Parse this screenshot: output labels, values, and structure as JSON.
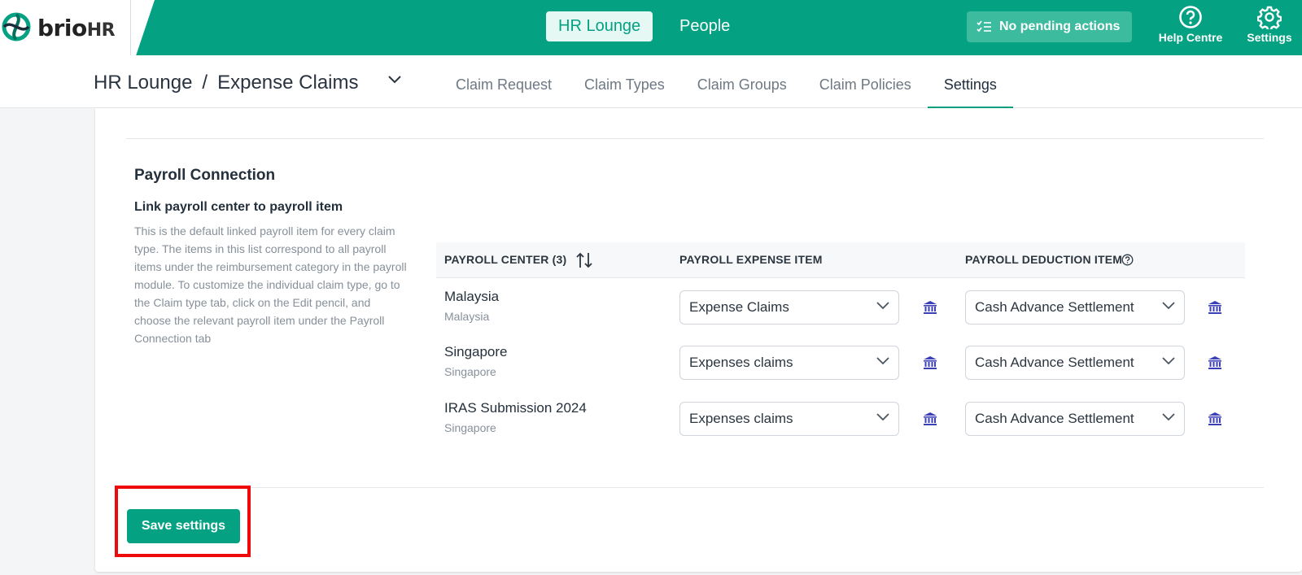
{
  "brand": {
    "name": "brio",
    "suffix": "HR",
    "colors": {
      "primary": "#05a183",
      "highlight": "#ee0a0a",
      "bank_icon": "#3b3fb8"
    }
  },
  "topnav": {
    "items": [
      {
        "label": "HR Lounge",
        "active": true
      },
      {
        "label": "People",
        "active": false
      }
    ],
    "pending_label": "No pending actions",
    "help_label": "Help Centre",
    "settings_label": "Settings"
  },
  "breadcrumb": {
    "root": "HR Lounge",
    "separator": "/",
    "current": "Expense Claims"
  },
  "tabs": [
    {
      "label": "Claim Request",
      "active": false
    },
    {
      "label": "Claim Types",
      "active": false
    },
    {
      "label": "Claim Groups",
      "active": false
    },
    {
      "label": "Claim Policies",
      "active": false
    },
    {
      "label": "Settings",
      "active": true
    }
  ],
  "section": {
    "title": "Payroll Connection",
    "subtitle": "Link payroll center to payroll item",
    "description": "This is the default linked payroll item for every claim type. The items in this list correspond to all payroll items under the reimbursement category in the payroll module. To customize the individual claim type, go to the Claim type tab, click on the Edit pencil, and choose the relevant payroll item under the Payroll Connection tab"
  },
  "table": {
    "headers": {
      "center": "PAYROLL CENTER (3)",
      "expense": "PAYROLL EXPENSE ITEM",
      "deduction": "PAYROLL DEDUCTION ITEM"
    },
    "rows": [
      {
        "name": "Malaysia",
        "country": "Malaysia",
        "expense": "Expense Claims",
        "deduction": "Cash Advance Settlement"
      },
      {
        "name": "Singapore",
        "country": "Singapore",
        "expense": "Expenses claims",
        "deduction": "Cash Advance Settlement"
      },
      {
        "name": "IRAS Submission 2024",
        "country": "Singapore",
        "expense": "Expenses claims",
        "deduction": "Cash Advance Settlement"
      }
    ]
  },
  "actions": {
    "save_label": "Save settings"
  }
}
